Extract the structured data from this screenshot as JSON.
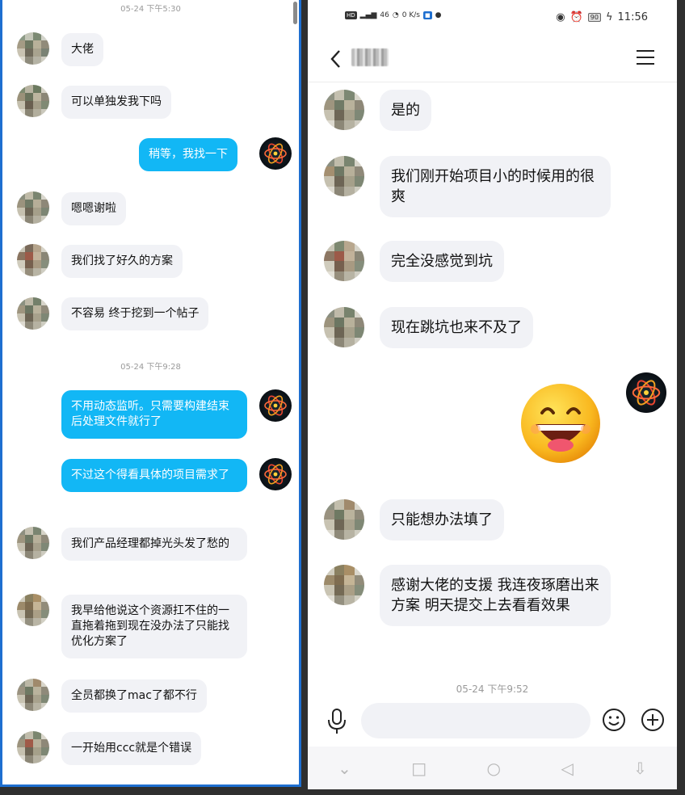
{
  "left_panel": {
    "timestamps": [
      "05-24 下午5:30",
      "05-24 下午9:28"
    ],
    "messages": [
      {
        "side": "left",
        "text": "大佬"
      },
      {
        "side": "left",
        "text": "可以单独发我下吗"
      },
      {
        "side": "right",
        "text": "稍等，我找一下"
      },
      {
        "side": "left",
        "text": "嗯嗯谢啦"
      },
      {
        "side": "left",
        "text": "我们找了好久的方案"
      },
      {
        "side": "left",
        "text": "不容易 终于挖到一个帖子"
      },
      {
        "side": "right",
        "text": "不用动态监听。只需要构建结束后处理文件就行了"
      },
      {
        "side": "right",
        "text": "不过这个得看具体的项目需求了"
      },
      {
        "side": "left",
        "text": "我们产品经理都掉光头发了愁的"
      },
      {
        "side": "left",
        "text": "我早给他说这个资源扛不住的一直拖着拖到现在没办法了只能找优化方案了"
      },
      {
        "side": "left",
        "text": "全员都换了mac了都不行"
      },
      {
        "side": "left",
        "text": "一开始用ccc就是个错误"
      }
    ]
  },
  "right_panel": {
    "status_bar": {
      "left_items": [
        "HD",
        "46",
        "0 K/s"
      ],
      "battery": "90",
      "time": "11:56"
    },
    "nav": {
      "back_icon": "chevron-left-icon",
      "menu_icon": "hamburger-menu-icon"
    },
    "messages": [
      {
        "side": "left",
        "text": "是的"
      },
      {
        "side": "left",
        "text": "我们刚开始项目小的时候用的很爽"
      },
      {
        "side": "left",
        "text": "完全没感觉到坑"
      },
      {
        "side": "left",
        "text": "现在跳坑也来不及了"
      },
      {
        "side": "right",
        "type": "emoji",
        "text": "grinning-face-emoji"
      },
      {
        "side": "left",
        "text": "只能想办法填了"
      },
      {
        "side": "left",
        "text": "感谢大佬的支援 我连夜琢磨出来方案 明天提交上去看看效果"
      }
    ],
    "timestamp": "05-24 下午9:52",
    "input": {
      "placeholder": ""
    },
    "colors": {
      "own_bubble": "#12b7f5",
      "other_bubble": "#f1f2f6"
    }
  }
}
